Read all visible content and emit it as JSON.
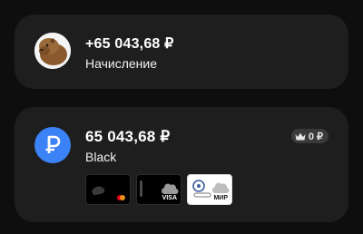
{
  "transaction": {
    "amount": "+65 043,68 ₽",
    "label": "Начисление",
    "avatar_icon": "capybara-avatar"
  },
  "account": {
    "balance": "65 043,68 ₽",
    "name": "Black",
    "icon": "ruble-icon",
    "icon_color": "#3b82f6",
    "badge_value": "0 ₽",
    "badge_icon": "crown-icon",
    "cards": [
      {
        "name": "mastercard-card",
        "style": "black"
      },
      {
        "name": "visa-card",
        "style": "black",
        "logo": "VISA"
      },
      {
        "name": "mir-card",
        "style": "white",
        "logo": "МИР"
      }
    ]
  }
}
